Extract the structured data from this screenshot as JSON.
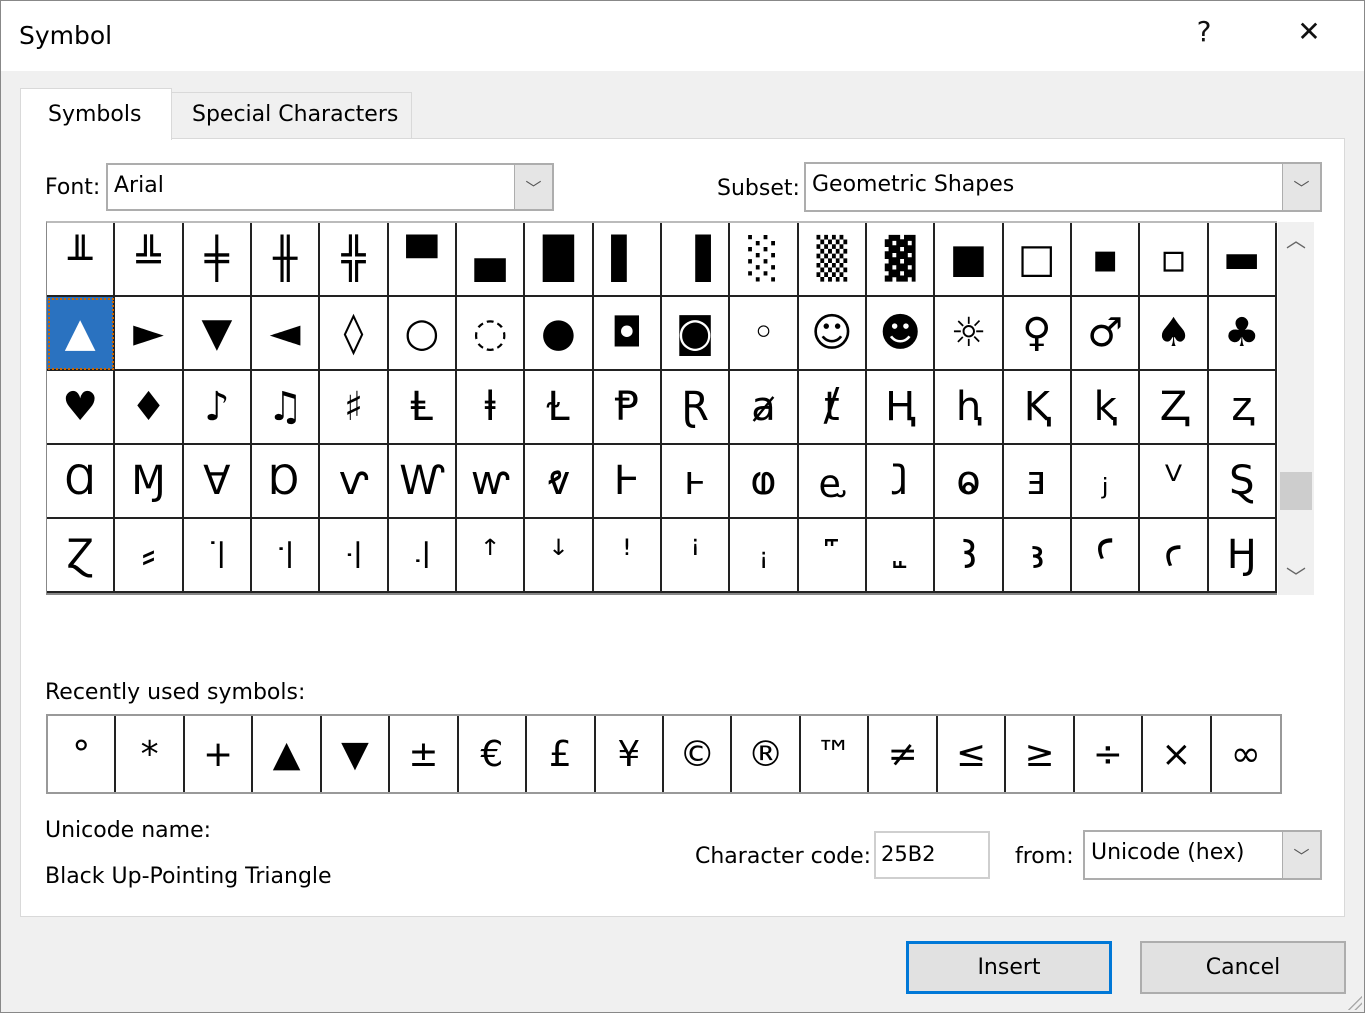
{
  "window": {
    "title": "Symbol",
    "help_label": "?",
    "close_label": "✕"
  },
  "tabs": [
    {
      "label": "Symbols",
      "selected": true
    },
    {
      "label": "Special Characters",
      "selected": false
    }
  ],
  "font": {
    "label": "Font:",
    "value": "Arial"
  },
  "subset": {
    "label": "Subset:",
    "value": "Geometric Shapes"
  },
  "symbol_grid": {
    "selected_index": 18,
    "rows": [
      [
        "╨",
        "╩",
        "╪",
        "╫",
        "╬",
        "▀",
        "▄",
        "█",
        "▌",
        "▐",
        "░",
        "▒",
        "▓",
        "■",
        "□",
        "▪",
        "▫",
        "▬"
      ],
      [
        "▲",
        "►",
        "▼",
        "◄",
        "◊",
        "○",
        "◌",
        "●",
        "◘",
        "◙",
        "◦",
        "☺",
        "☻",
        "☼",
        "♀",
        "♂",
        "♠",
        "♣"
      ],
      [
        "♥",
        "♦",
        "♪",
        "♫",
        "♯",
        "Ⱡ",
        "ⱡ",
        "Ɫ",
        "Ᵽ",
        "Ɽ",
        "ⱥ",
        "ⱦ",
        "Ⱨ",
        "ⱨ",
        "Ⱪ",
        "ⱪ",
        "Ⱬ",
        "ⱬ"
      ],
      [
        "Ɑ",
        "Ɱ",
        "Ɐ",
        "Ɒ",
        "ⱱ",
        "Ⱳ",
        "ⱳ",
        "ⱴ",
        "Ⱶ",
        "ⱶ",
        "ⱷ",
        "ⱸ",
        "ⱹ",
        "ⱺ",
        "ⱻ",
        "ⱼ",
        "ⱽ",
        "Ȿ"
      ],
      [
        "Ɀ",
        "⸗",
        "꜈",
        "꜉",
        "꜊",
        "꜋",
        "ꜛ",
        "ꜜ",
        "ꜝ",
        "ꜞ",
        "ꜟ",
        "꜠",
        "꜡",
        "Ꜣ",
        "ꜣ",
        "Ꜥ",
        "ꜥ",
        "Ꜧ"
      ]
    ]
  },
  "recent": {
    "label": "Recently used symbols:",
    "items": [
      "°",
      "*",
      "+",
      "▲",
      "▼",
      "±",
      "€",
      "£",
      "¥",
      "©",
      "®",
      "™",
      "≠",
      "≤",
      "≥",
      "÷",
      "×",
      "∞"
    ]
  },
  "unicode_name": {
    "label": "Unicode name:",
    "value": "Black Up-Pointing Triangle"
  },
  "char_code": {
    "label": "Character code:",
    "value": "25B2"
  },
  "from": {
    "label": "from:",
    "value": "Unicode (hex)"
  },
  "buttons": {
    "insert": "Insert",
    "cancel": "Cancel"
  },
  "colors": {
    "selection": "#2a72c0",
    "default_button_border": "#0078d7"
  }
}
